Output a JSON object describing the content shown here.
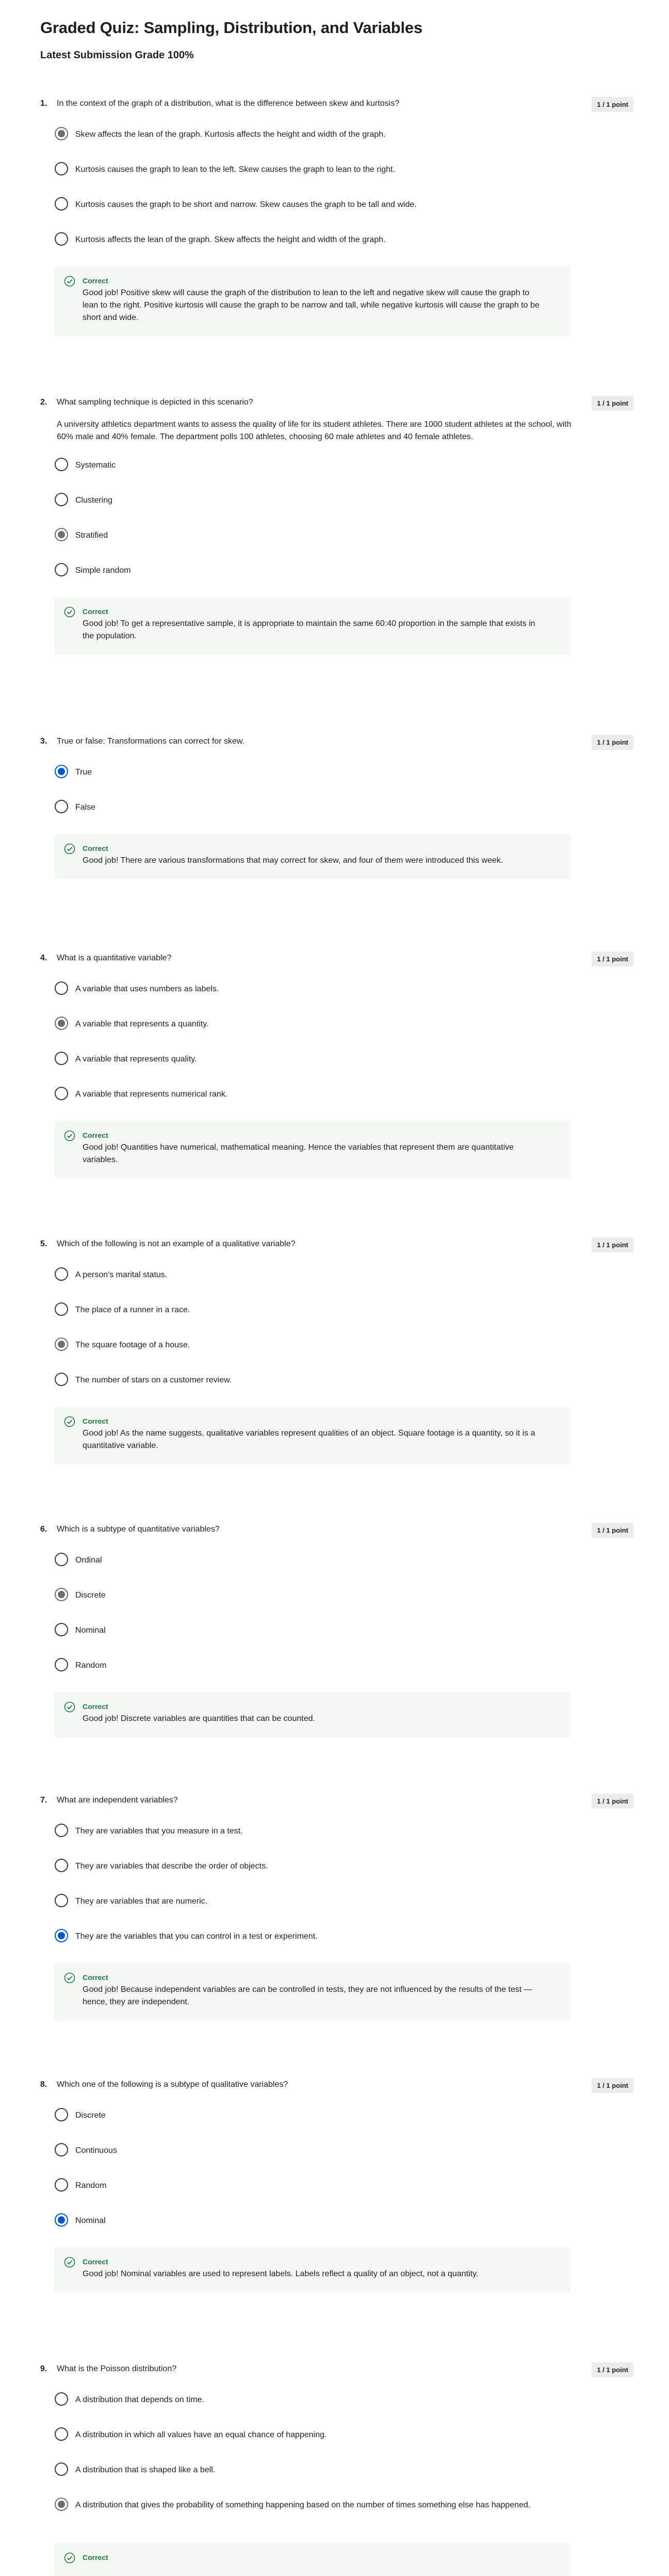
{
  "page_title": "Graded Quiz: Sampling, Distribution, and Variables",
  "grade": "Latest Submission Grade 100%",
  "colors": {
    "selected_blue": "#0056d2",
    "selected_gray": "#6e6e6e",
    "correct_green": "#1e7a3c",
    "feedback_bg": "#f3f8f3"
  },
  "questions": [
    {
      "number": "1.",
      "text": "In the context of the graph of a distribution, what is the difference between skew and kurtosis?",
      "points": "1 / 1 point",
      "options": [
        "Skew affects the lean of the graph. Kurtosis affects the height and width of the graph.",
        "Kurtosis causes the graph to lean to the left. Skew causes the graph to lean to the right.",
        "Kurtosis causes the graph to be short and narrow. Skew causes the graph to be tall and wide.",
        "Kurtosis affects the lean of the graph. Skew affects the height and width of the graph."
      ],
      "feedback_title": "Correct",
      "feedback": "Good job! Positive skew will cause the graph of the distribution to lean to the left and negative skew will cause the graph to lean to the right. Positive kurtosis will cause the graph to be narrow and tall, while negative kurtosis will cause the graph to be short and wide."
    },
    {
      "number": "2.",
      "text": "What sampling technique is depicted in this scenario?",
      "description": "A university athletics department wants to assess the quality of life for its student athletes. There are 1000 student athletes at the school, with 60% male and 40% female. The department polls 100 athletes, choosing 60 male athletes and 40 female athletes.",
      "points": "1 / 1 point",
      "options": [
        "Systematic",
        "Clustering",
        "Stratified",
        "Simple random"
      ],
      "feedback_title": "Correct",
      "feedback": "Good job! To get a representative sample, it is appropriate to maintain the same 60:40 proportion in the sample that exists in the population."
    },
    {
      "number": "3.",
      "text": "True or false: Transformations can correct for skew.",
      "points": "1 / 1 point",
      "options": [
        "True",
        "False"
      ],
      "feedback_title": "Correct",
      "feedback": "Good job! There are various transformations that may correct for skew, and four of them were introduced this week."
    },
    {
      "number": "4.",
      "text": "What is a quantitative variable?",
      "points": "1 / 1 point",
      "options": [
        "A variable that uses numbers as labels.",
        "A variable that represents a quantity.",
        "A variable that represents quality.",
        "A variable that represents numerical rank."
      ],
      "feedback_title": "Correct",
      "feedback": "Good job! Quantities have numerical, mathematical meaning. Hence the variables that represent them are quantitative variables."
    },
    {
      "number": "5.",
      "text": "Which of the following is not an example of a qualitative variable?",
      "points": "1 / 1 point",
      "options": [
        "A person's marital status.",
        "The place of a runner in a race.",
        "The square footage of a house.",
        "The number of stars on a customer review."
      ],
      "feedback_title": "Correct",
      "feedback": "Good job! As the name suggests, qualitative variables represent qualities of an object. Square footage is a quantity, so it is a quantitative variable."
    },
    {
      "number": "6.",
      "text": "Which is a subtype of quantitative variables?",
      "points": "1 / 1 point",
      "options": [
        "Ordinal",
        "Discrete",
        "Nominal",
        "Random"
      ],
      "feedback_title": "Correct",
      "feedback": "Good job! Discrete variables are quantities that can be counted."
    },
    {
      "number": "7.",
      "text": "What are independent variables?",
      "points": "1 / 1 point",
      "options": [
        "They are variables that you measure in a test.",
        "They are variables that describe the order of objects.",
        "They are variables that are numeric.",
        "They are the variables that you can control in a test or experiment."
      ],
      "feedback_title": "Correct",
      "feedback": "Good job! Because independent variables are can be controlled in tests, they are not influenced by the results of the test — hence, they are independent."
    },
    {
      "number": "8.",
      "text": "Which one of the following is a subtype of qualitative variables?",
      "points": "1 / 1 point",
      "options": [
        "Discrete",
        "Continuous",
        "Random",
        "Nominal"
      ],
      "feedback_title": "Correct",
      "feedback": "Good job! Nominal variables are used to represent labels. Labels reflect a quality of an object, not a quantity."
    },
    {
      "number": "9.",
      "text": "What is the Poisson distribution?",
      "points": "1 / 1 point",
      "options": [
        "A distribution that depends on time.",
        "A distribution in which all values have an equal chance of happening.",
        "A distribution that is shaped like a bell.",
        "A distribution that gives the probability of something happening based on the number of times something else has happened."
      ],
      "feedback_title": "Correct",
      "feedback": ""
    }
  ]
}
